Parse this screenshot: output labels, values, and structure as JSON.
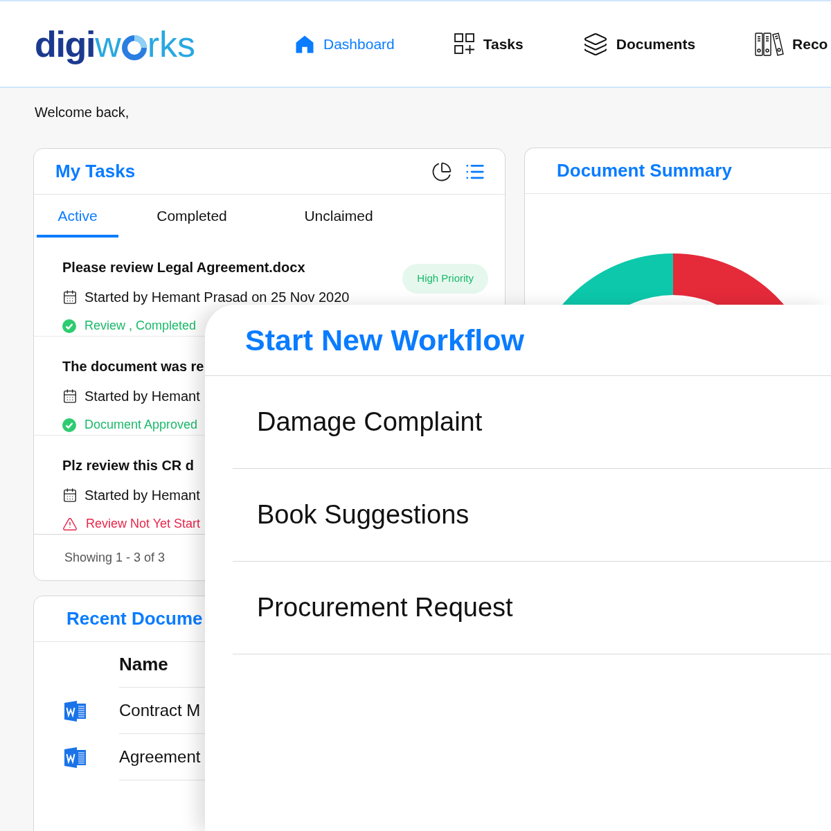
{
  "logo": {
    "primary": "digi",
    "secondary": "w",
    "suffix": "rks"
  },
  "nav": [
    {
      "label": "Dashboard",
      "kind": "home",
      "selected": true
    },
    {
      "label": "Tasks",
      "kind": "grid",
      "selected": false
    },
    {
      "label": "Documents",
      "kind": "layers",
      "selected": false
    },
    {
      "label": "Reco",
      "kind": "binders",
      "selected": false
    }
  ],
  "greeting": "Welcome back,",
  "my_tasks": {
    "title": "My Tasks",
    "view_buttons": [
      {
        "kind": "chart",
        "selected": false
      },
      {
        "kind": "list",
        "selected": true
      }
    ],
    "tabs": [
      {
        "label": "Active",
        "selected": true
      },
      {
        "label": "Completed",
        "selected": false
      },
      {
        "label": "Unclaimed",
        "selected": false
      }
    ],
    "tasks": [
      {
        "title": "Please review Legal Agreement.docx",
        "started": "Started by Hemant Prasad on 25 Nov 2020",
        "status": {
          "kind": "done",
          "text": "Review , Completed"
        },
        "badge": "High Priority"
      },
      {
        "title": "The document was re",
        "started": "Started by Hemant",
        "status": {
          "kind": "done",
          "text": "Document Approved"
        }
      },
      {
        "title": "Plz review this CR d",
        "started": "Started by Hemant",
        "status": {
          "kind": "warning",
          "text": "Review Not Yet Start"
        }
      }
    ],
    "footer": "Showing 1 - 3 of 3"
  },
  "document_summary": {
    "title": "Document Summary"
  },
  "recent_documents": {
    "title": "Recent Docume",
    "columns": [
      "Name"
    ],
    "rows": [
      {
        "name": "Contract M"
      },
      {
        "name": "Agreement"
      }
    ]
  },
  "workflow_dialog": {
    "title": "Start New Workflow",
    "items": [
      "Damage Complaint",
      "Book Suggestions",
      "Procurement Request"
    ]
  }
}
